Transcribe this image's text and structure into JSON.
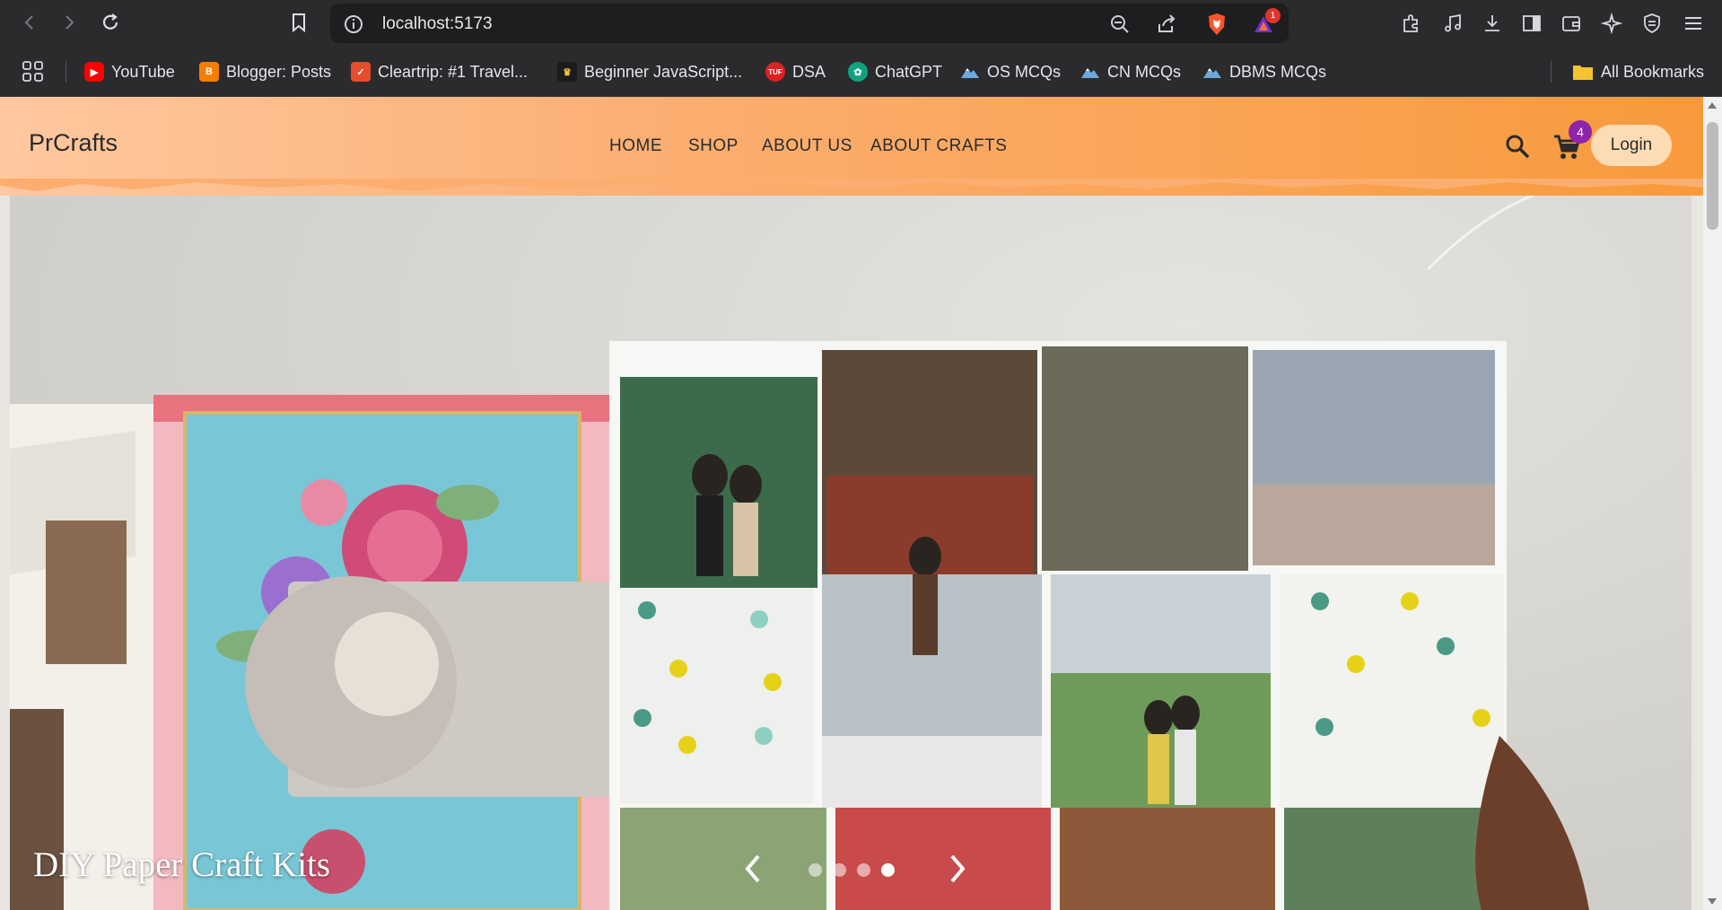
{
  "browser": {
    "url": "localhost:5173",
    "notification_count": "1",
    "bookmarks": [
      {
        "label": "YouTube",
        "icon": "youtube-icon",
        "color": "#ff0000"
      },
      {
        "label": "Blogger: Posts",
        "icon": "blogger-icon",
        "color": "#f57d00"
      },
      {
        "label": "Cleartrip: #1 Travel...",
        "icon": "cleartrip-icon",
        "color": "#e74c2b"
      },
      {
        "label": "Beginner JavaScript...",
        "icon": "crown-icon",
        "color": "#1b1b1b"
      },
      {
        "label": "DSA",
        "icon": "tuf-icon",
        "color": "#e02020"
      },
      {
        "label": "ChatGPT",
        "icon": "chatgpt-icon",
        "color": "#10a37f"
      },
      {
        "label": "OS MCQs",
        "icon": "mountain-icon",
        "color": "#6fa8dc"
      },
      {
        "label": "CN MCQs",
        "icon": "mountain-icon",
        "color": "#6fa8dc"
      },
      {
        "label": "DBMS MCQs",
        "icon": "mountain-icon",
        "color": "#6fa8dc"
      }
    ],
    "all_bookmarks": "All Bookmarks"
  },
  "site": {
    "logo": "PrCrafts",
    "nav": [
      "HOME",
      "SHOP",
      "ABOUT US",
      "ABOUT CRAFTS"
    ],
    "cart_count": "4",
    "login": "Login",
    "accent": "#f89a3c",
    "badge_color": "#8e24aa"
  },
  "hero": {
    "caption": "DIY Paper Craft Kits",
    "slide_count": 4,
    "active_slide": 4
  }
}
